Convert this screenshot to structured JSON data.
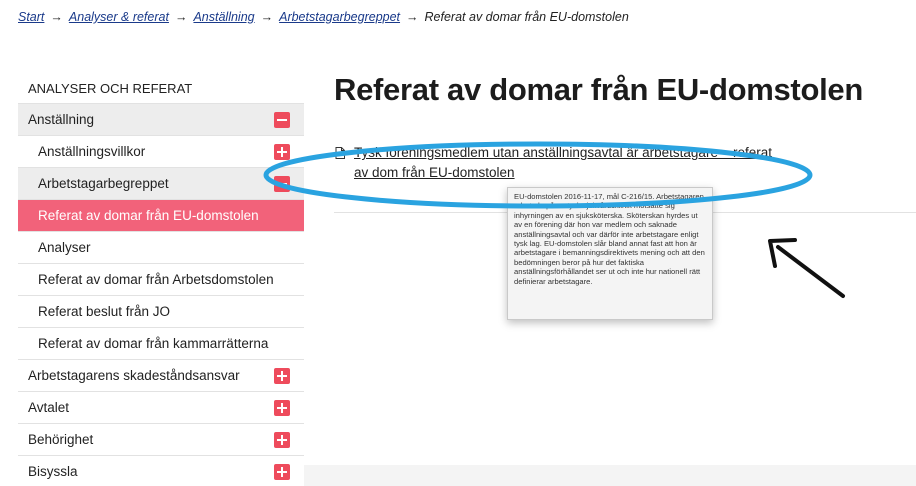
{
  "breadcrumb": {
    "items": [
      "Start",
      "Analyser & referat",
      "Anställning",
      "Arbetstagarbegreppet"
    ],
    "current": "Referat av domar från EU-domstolen",
    "separator": "→"
  },
  "sidebar": {
    "heading": "ANALYSER OCH REFERAT",
    "items": [
      {
        "label": "Anställning",
        "toggle": "minus"
      },
      {
        "label": "Anställningsvillkor",
        "toggle": "plus"
      },
      {
        "label": "Arbetstagarbegreppet",
        "toggle": "minus"
      },
      {
        "label": "Referat av domar från EU-domstolen",
        "active": true
      },
      {
        "label": "Analyser"
      },
      {
        "label": "Referat av domar från Arbetsdomstolen"
      },
      {
        "label": "Referat beslut från JO"
      },
      {
        "label": "Referat av domar från kammarrätterna"
      },
      {
        "label": "Arbetstagarens skadeståndsansvar",
        "toggle": "plus"
      },
      {
        "label": "Avtalet",
        "toggle": "plus"
      },
      {
        "label": "Behörighet",
        "toggle": "plus"
      },
      {
        "label": "Bisyssla",
        "toggle": "plus"
      }
    ]
  },
  "main": {
    "title": "Referat av domar från EU-domstolen",
    "result_link": "Tysk föreningsmedlem utan anställningsavtal är arbetstagare – referat av dom från EU-domstolen",
    "tooltip": "EU-domstolen 2016-11-17, mål C-216/15. Arbetstagaren arbetade på en tysk sjukvårdsklinik motsatte sig inhyrningen av en sjuksköterska. Sköterskan hyrdes ut av en förening där hon var medlem och saknade anställningsavtal och var därför inte arbetstagare enligt tysk lag. EU-domstolen slår bland annat fast att hon är arbetstagare i bemanningsdirektivets mening och att den bedömningen beror på hur det faktiska anställningsförhållandet ser ut och inte hur nationell rätt definierar arbetstagare."
  },
  "colors": {
    "accent": "#f2627a",
    "toggle": "#ee4b5c",
    "highlight_ring": "#2aa3e0",
    "link": "#1a3a8a"
  },
  "icons": {
    "document": "document-icon",
    "expand": "plus-icon",
    "collapse": "minus-icon",
    "annotation_arrow": "arrow-icon"
  }
}
